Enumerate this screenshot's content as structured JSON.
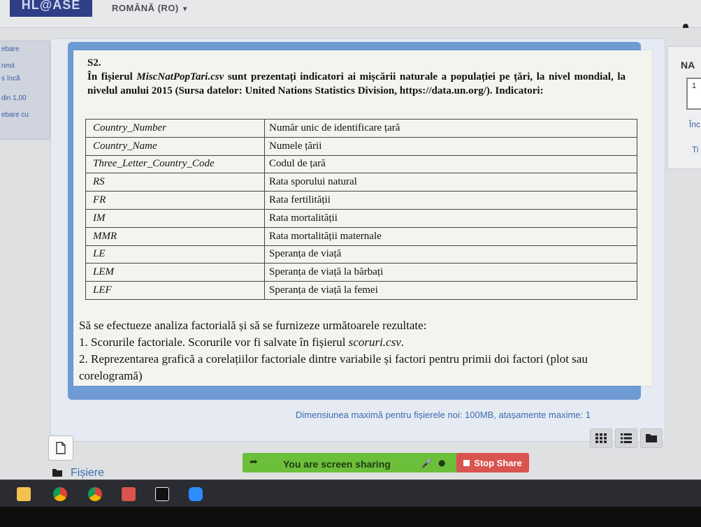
{
  "header": {
    "logo": "HL@ASE",
    "language": "ROMÂNĂ (RO)"
  },
  "quiz_nav": {
    "lines": [
      "ebare",
      "nmit",
      "s încă",
      "din 1,00",
      "ebare cu"
    ]
  },
  "right_panel": {
    "title": "NA",
    "box": "1",
    "line1": "Înc",
    "line2": "Ti"
  },
  "question": {
    "heading": "S2.",
    "p_before": "În fișierul ",
    "file_name": "MiscNatPopTari.csv",
    "p_after": " sunt prezentați indicatori ai mișcării naturale a populației pe țări, la nivel mondial, la nivelul anului 2015 (Sursa datelor: United Nations Statistics Division, https://data.un.org/). Indicatori:",
    "table": [
      {
        "code": "Country_Number",
        "desc": "Număr unic de identificare țară"
      },
      {
        "code": "Country_Name",
        "desc": "Numele țării"
      },
      {
        "code": "Three_Letter_Country_Code",
        "desc": "Codul de țară"
      },
      {
        "code": "RS",
        "desc": "Rata sporului natural"
      },
      {
        "code": "FR",
        "desc": "Rata fertilității"
      },
      {
        "code": "IM",
        "desc": "Rata mortalității"
      },
      {
        "code": "MMR",
        "desc": "Rata mortalității maternale"
      },
      {
        "code": "LE",
        "desc": "Speranța de viață"
      },
      {
        "code": "LEM",
        "desc": "Speranța de viață la bărbați"
      },
      {
        "code": "LEF",
        "desc": "Speranța de viață la femei"
      }
    ],
    "task_intro": "Să se efectueze analiza factorială și să se furnizeze următoarele rezultate:",
    "task1_before": "1. Scorurile factoriale. Scorurile vor fi salvate în fișierul ",
    "task1_file": "scoruri.csv",
    "task1_after": ".",
    "task2": "2. Reprezentarea grafică a corelațiilor factoriale dintre variabile și factori pentru primii doi factori (plot sau corelogramă)"
  },
  "upload": {
    "limits": "Dimensiunea maximă pentru fișierele noi: 100MB, atașamente maxime: 1",
    "files_label": "Fișiere"
  },
  "zoom": {
    "sharing_text": "You are screen sharing",
    "stop_label": "Stop Share",
    "bar_color": "#6cbf3a",
    "stop_color": "#d9534f"
  },
  "icons": [
    "bell-icon",
    "file-icon",
    "folder-icon",
    "grid-view-icon",
    "list-view-icon",
    "folder-view-icon",
    "arrow-icon",
    "mic-icon",
    "shield-icon",
    "stop-icon"
  ],
  "taskbar": [
    "file-explorer",
    "chrome",
    "chrome",
    "app-red",
    "pycharm",
    "zoom"
  ]
}
